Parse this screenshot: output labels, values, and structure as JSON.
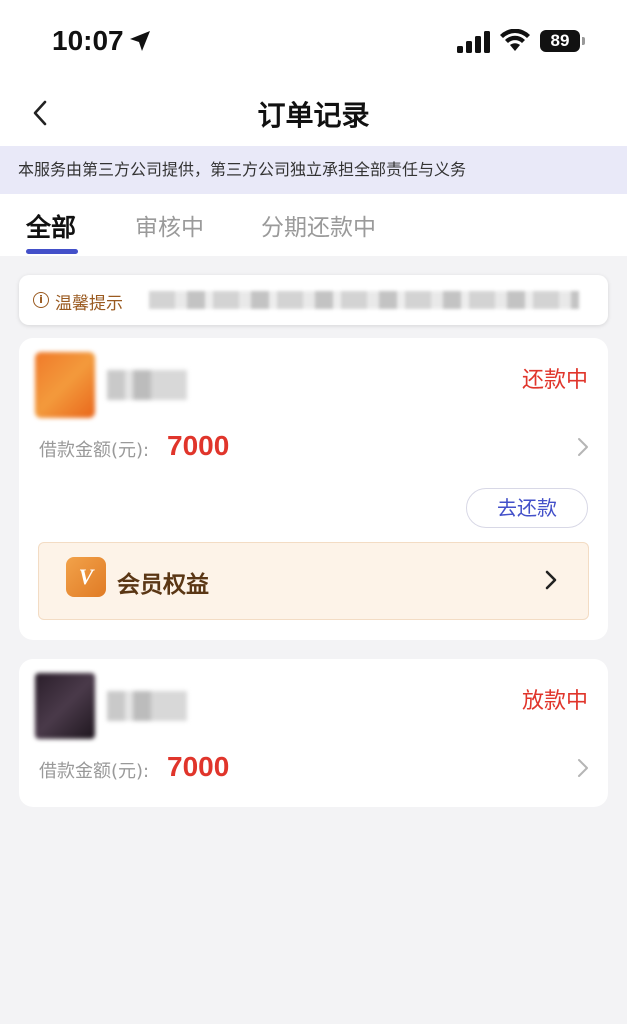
{
  "status_bar": {
    "time": "10:07",
    "battery": "89",
    "icons": [
      "location-arrow-icon",
      "cellular-signal-icon",
      "wifi-icon",
      "battery-icon"
    ]
  },
  "nav": {
    "title": "订单记录",
    "back_icon": "chevron-left-icon"
  },
  "notice": {
    "text": "本服务由第三方公司提供，第三方公司独立承担全部责任与义务"
  },
  "tabs": [
    {
      "label": "全部",
      "active": true
    },
    {
      "label": "审核中",
      "active": false
    },
    {
      "label": "分期还款中",
      "active": false
    }
  ],
  "tip": {
    "icon": "info-circle-icon",
    "label": "温馨提示"
  },
  "orders": [
    {
      "status": "还款中",
      "amount_label": "借款金额(元):",
      "amount": "7000",
      "action_label": "去还款",
      "vip": {
        "badge": "V",
        "label": "会员权益"
      }
    },
    {
      "status": "放款中",
      "amount_label": "借款金额(元):",
      "amount": "7000"
    }
  ],
  "colors": {
    "accent": "#4350c9",
    "status_red": "#e0352b",
    "tip_brown": "#9a5a20",
    "vip_bg": "#fdf3e8",
    "page_bg": "#f3f3f5"
  }
}
